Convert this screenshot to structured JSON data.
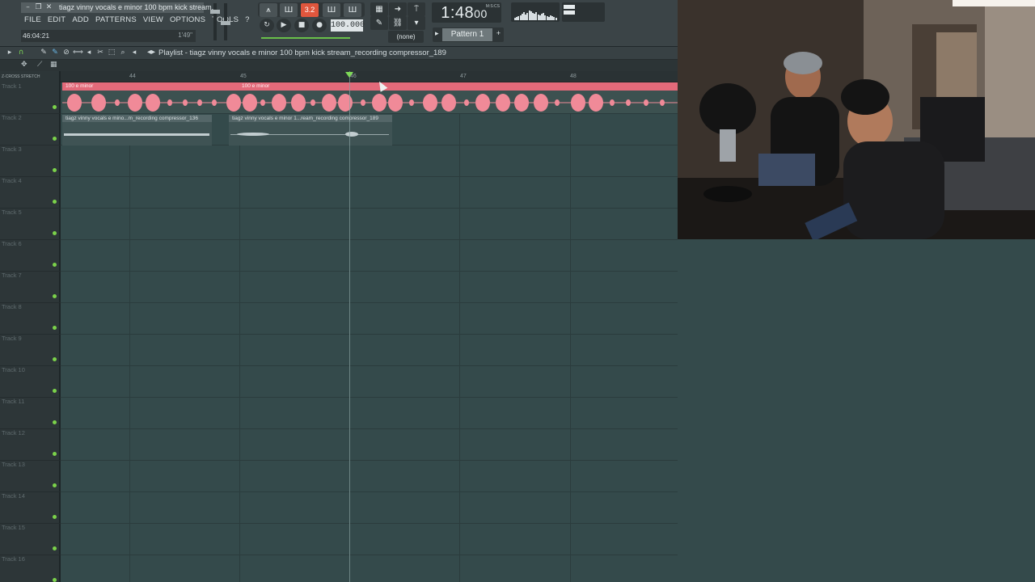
{
  "window": {
    "title": "tiagz vinny vocals e minor 100 bpm kick stream.",
    "min_icon": "minimize-icon",
    "max_icon": "restore-icon",
    "close_icon": "close-icon"
  },
  "menu": [
    "FILE",
    "EDIT",
    "ADD",
    "PATTERNS",
    "VIEW",
    "OPTIONS",
    "TOOLS",
    "?"
  ],
  "hint_bar": {
    "left": "46:04:21",
    "right": "1'49\""
  },
  "transport": {
    "counter_label": "3.2",
    "tempo": "100.000",
    "time": "1:48",
    "time_sub": "00",
    "time_unit": "M:S:CS",
    "snap": "(none)",
    "pattern": "Pattern 1"
  },
  "playlist": {
    "title": "Playlist - tiagz vinny vocals e minor 100 bpm kick stream_recording compressor_189",
    "ruler": [
      "44",
      "45",
      "46",
      "47",
      "48"
    ],
    "zoom_label": "Z-CROSS  STRETCH",
    "tracks": [
      "Track 1",
      "Track 2",
      "Track 3",
      "Track 4",
      "Track 5",
      "Track 6",
      "Track 7",
      "Track 8",
      "Track 9",
      "Track 10",
      "Track 11",
      "Track 12",
      "Track 13",
      "Track 14",
      "Track 15",
      "Track 16"
    ],
    "clips": {
      "pink_label_a": "100 e minor",
      "pink_label_b": "100 e minor",
      "gray_a": "tiagz vinny vocals e mino...m_recording compressor_136",
      "gray_b": "tiagz vinny vocals e minor 1...ream_recording compressor_189"
    }
  },
  "colors": {
    "accent": "#e36a7a",
    "grid": "#344a4b",
    "led": "#7bd24a",
    "counter_bg": "#e0563d"
  }
}
